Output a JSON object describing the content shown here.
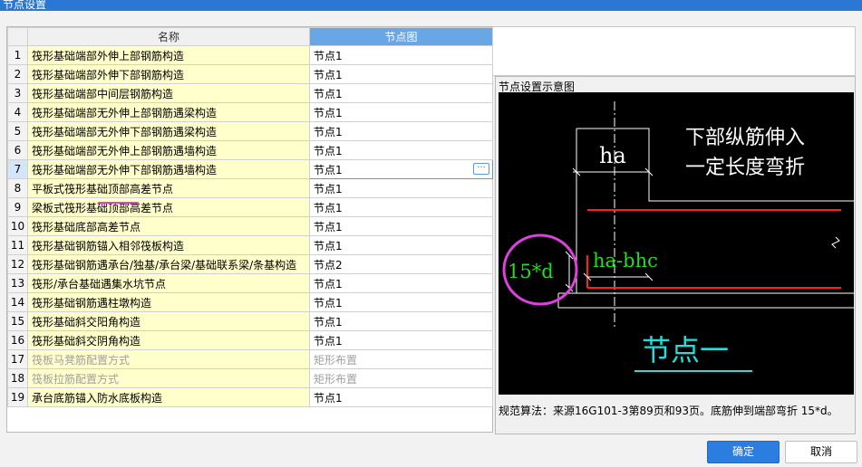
{
  "window": {
    "title": "节点设置"
  },
  "table": {
    "col_name": "名称",
    "col_node": "节点图",
    "rows": [
      {
        "idx": "1",
        "name": "筏形基础端部外伸上部钢筋构造",
        "node": "节点1"
      },
      {
        "idx": "2",
        "name": "筏形基础端部外伸下部钢筋构造",
        "node": "节点1"
      },
      {
        "idx": "3",
        "name": "筏形基础端部中间层钢筋构造",
        "node": "节点1"
      },
      {
        "idx": "4",
        "name": "筏形基础端部无外伸上部钢筋遇梁构造",
        "node": "节点1"
      },
      {
        "idx": "5",
        "name": "筏形基础端部无外伸下部钢筋遇梁构造",
        "node": "节点1"
      },
      {
        "idx": "6",
        "name": "筏形基础端部无外伸上部钢筋遇墙构造",
        "node": "节点1"
      },
      {
        "idx": "7",
        "name": "筏形基础端部无外伸下部钢筋遇墙构造",
        "node": "节点1"
      },
      {
        "idx": "8",
        "name": "平板式筏形基础顶部高差节点",
        "node": "节点1"
      },
      {
        "idx": "9",
        "name": "梁板式筏形基础顶部高差节点",
        "node": "节点1"
      },
      {
        "idx": "10",
        "name": "筏形基础底部高差节点",
        "node": "节点1"
      },
      {
        "idx": "11",
        "name": "筏形基础钢筋锚入相邻筏板构造",
        "node": "节点1"
      },
      {
        "idx": "12",
        "name": "筏形基础钢筋遇承台/独基/承台梁/基础联系梁/条基构造",
        "node": "节点2"
      },
      {
        "idx": "13",
        "name": "筏形/承台基础遇集水坑节点",
        "node": "节点1"
      },
      {
        "idx": "14",
        "name": "筏形基础钢筋遇柱墩构造",
        "node": "节点1"
      },
      {
        "idx": "15",
        "name": "筏形基础斜交阳角构造",
        "node": "节点1"
      },
      {
        "idx": "16",
        "name": "筏形基础斜交阴角构造",
        "node": "节点1"
      },
      {
        "idx": "17",
        "name": "筏板马凳筋配置方式",
        "node": "矩形布置"
      },
      {
        "idx": "18",
        "name": "筏板拉筋配置方式",
        "node": "矩形布置"
      },
      {
        "idx": "19",
        "name": "承台底筋锚入防水底板构造",
        "node": "节点1"
      }
    ],
    "ellipsis": "···"
  },
  "preview": {
    "title": "节点设置示意图",
    "text_line1": "下部纵筋伸入",
    "text_line2": "一定长度弯折",
    "label_ha": "ha",
    "label_ha_bhc": "ha-bhc",
    "label_15d": "15*d",
    "caption": "节点一",
    "note": "规范算法：来源16G101-3第89页和93页。底筋伸到端部弯折 15*d。"
  },
  "buttons": {
    "ok": "确定",
    "cancel": "取消"
  },
  "colors": {
    "accent": "#2b7de0",
    "rebar": "#ff2020",
    "dim_green": "#22dd22",
    "caption_cyan": "#22dddd",
    "mark_magenta": "#e040e0"
  }
}
